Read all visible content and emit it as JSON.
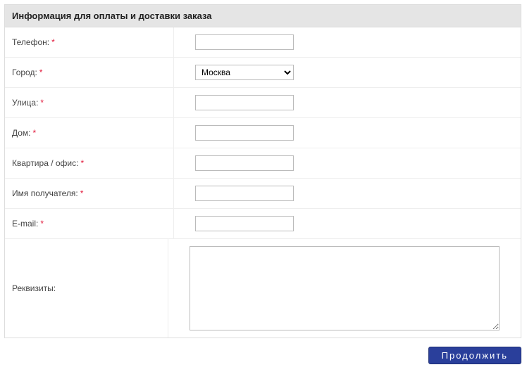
{
  "header": {
    "title": "Информация для оплаты и доставки заказа"
  },
  "fields": {
    "phone": {
      "label": "Телефон:",
      "required": true,
      "value": ""
    },
    "city": {
      "label": "Город:",
      "required": true,
      "value": "Москва",
      "options": [
        "Москва"
      ]
    },
    "street": {
      "label": "Улица:",
      "required": true,
      "value": ""
    },
    "house": {
      "label": "Дом:",
      "required": true,
      "value": ""
    },
    "apartment": {
      "label": "Квартира / офис:",
      "required": true,
      "value": ""
    },
    "recipient": {
      "label": "Имя получателя:",
      "required": true,
      "value": ""
    },
    "email": {
      "label": "E-mail:",
      "required": true,
      "value": ""
    },
    "requisites": {
      "label": "Реквизиты:",
      "required": false,
      "value": ""
    }
  },
  "required_mark": "*",
  "buttons": {
    "continue": "Продолжить"
  }
}
